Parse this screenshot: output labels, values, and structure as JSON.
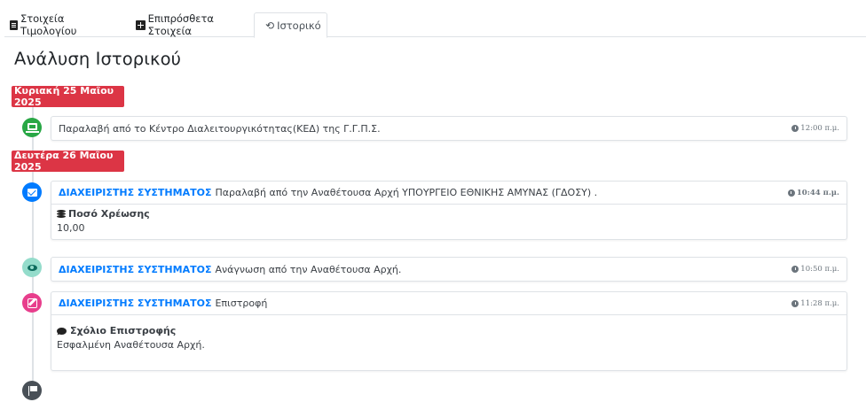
{
  "tabs": [
    {
      "label": "Στοιχεία Τιμολογίου",
      "icon": "document-icon",
      "active": false
    },
    {
      "label": "Επιπρόσθετα Στοιχεία",
      "icon": "plus-square-icon",
      "active": false
    },
    {
      "label": "Ιστορικό",
      "icon": "history-icon",
      "active": true
    }
  ],
  "page_title": "Ανάλυση Ιστορικού",
  "colors": {
    "date_badge": "#dc3545",
    "actor_link": "#007bff",
    "green": "#28a745",
    "blue": "#007bff",
    "teal": "#94dccb",
    "pink": "#e83e8c",
    "dark": "#495057"
  },
  "dates": [
    "Κυριακή 25 Μαΐου 2025",
    "Δευτέρα 26 Μαΐου 2025"
  ],
  "events": [
    {
      "icon": "laptop-icon",
      "text": "Παραλαβή από το Κέντρο Διαλειτουργικότητας(ΚΕΔ) της Γ.Γ.Π.Σ.",
      "time": "12:00 π.μ."
    },
    {
      "icon": "envelope-open-icon",
      "actor": "ΔΙΑΧΕΙΡΙΣΤΗΣ ΣΥΣΤΗΜΑΤΟΣ",
      "text": "Παραλαβή από την Αναθέτουσα Αρχή ΥΠΟΥΡΓΕΙΟ ΕΘΝΙΚΗΣ ΑΜΥΝΑΣ (ΓΔΟΣΥ) .",
      "time": "10:44 π.μ.",
      "detail_label": "Ποσό Χρέωσης",
      "detail_value": "10,00"
    },
    {
      "icon": "eye-icon",
      "actor": "ΔΙΑΧΕΙΡΙΣΤΗΣ ΣΥΣΤΗΜΑΤΟΣ",
      "text": "Ανάγνωση από την Αναθέτουσα Αρχή.",
      "time": "10:50 π.μ."
    },
    {
      "icon": "edit-icon",
      "actor": "ΔΙΑΧΕΙΡΙΣΤΗΣ ΣΥΣΤΗΜΑΤΟΣ",
      "text": "Επιστροφή",
      "time": "11:28 π.μ.",
      "detail_label": "Σχόλιο Επιστροφής",
      "detail_value": "Εσφαλμένη Αναθέτουσα Αρχή."
    }
  ],
  "end_icon": "flag-icon"
}
